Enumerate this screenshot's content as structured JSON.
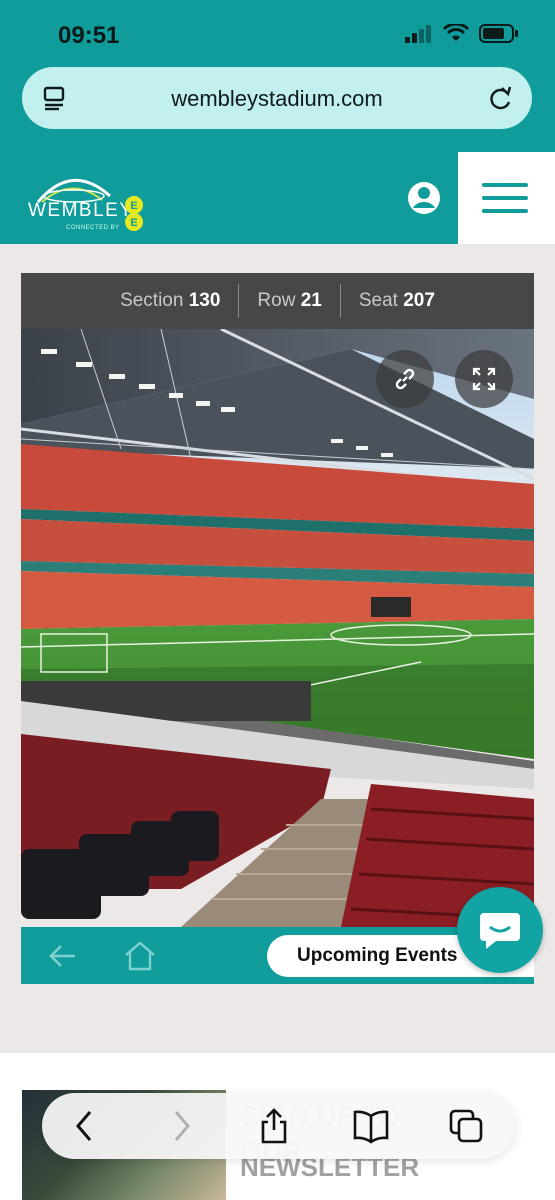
{
  "status_bar": {
    "time": "09:51"
  },
  "browser": {
    "url": "wembleystadium.com"
  },
  "site_header": {
    "logo_text": "WEMBLEY",
    "logo_subtext": "CONNECTED BY",
    "logo_partner": "EE"
  },
  "seat_info": {
    "section_label": "Section",
    "section_value": "130",
    "row_label": "Row",
    "row_value": "21",
    "seat_label": "Seat",
    "seat_value": "207"
  },
  "bottom_bar": {
    "events_label": "Upcoming Events"
  },
  "promo": {
    "headline": "SIGN UP TO OUR",
    "subline": "NEWSLETTER"
  },
  "colors": {
    "brand_teal": "#0f9c9a",
    "seat_bar": "#474747",
    "url_bar": "#c1f0ef"
  },
  "icons": [
    "page-menu-icon",
    "reload-icon",
    "user-account-icon",
    "hamburger-menu-icon",
    "link-icon",
    "fullscreen-icon",
    "back-arrow-icon",
    "home-icon",
    "chat-icon",
    "safari-back-icon",
    "safari-forward-icon",
    "share-icon",
    "bookmarks-icon",
    "tabs-icon"
  ]
}
